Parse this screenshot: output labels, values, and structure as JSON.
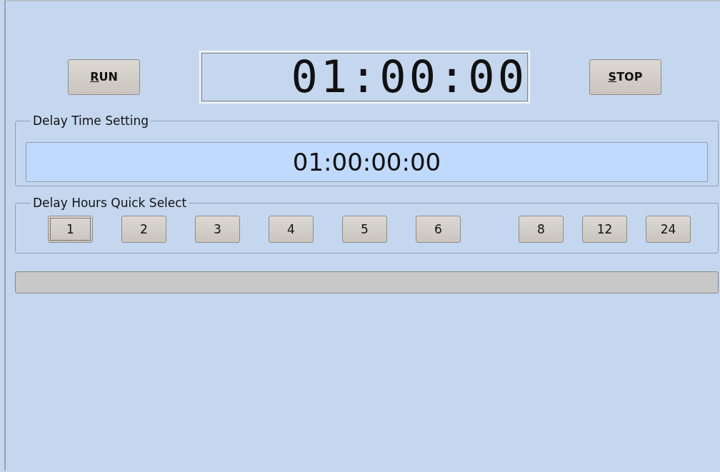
{
  "run_button": {
    "label": "RUN",
    "shortcut_underlined": true
  },
  "display": {
    "value": "01:00:00"
  },
  "stop_button": {
    "label": "STOP",
    "shortcut_underlined": true
  },
  "delay_time_setting": {
    "title": "Delay Time Setting",
    "value": "01:00:00:00"
  },
  "quick_select": {
    "title": "Delay Hours Quick Select",
    "buttons": [
      {
        "label": "1",
        "focused": true
      },
      {
        "label": "2",
        "focused": false
      },
      {
        "label": "3",
        "focused": false
      },
      {
        "label": "4",
        "focused": false
      },
      {
        "label": "5",
        "focused": false
      },
      {
        "label": "6",
        "focused": false
      },
      {
        "label": "8",
        "focused": false
      },
      {
        "label": "12",
        "focused": false
      },
      {
        "label": "24",
        "focused": false
      }
    ]
  },
  "progress": {
    "level": 0
  }
}
